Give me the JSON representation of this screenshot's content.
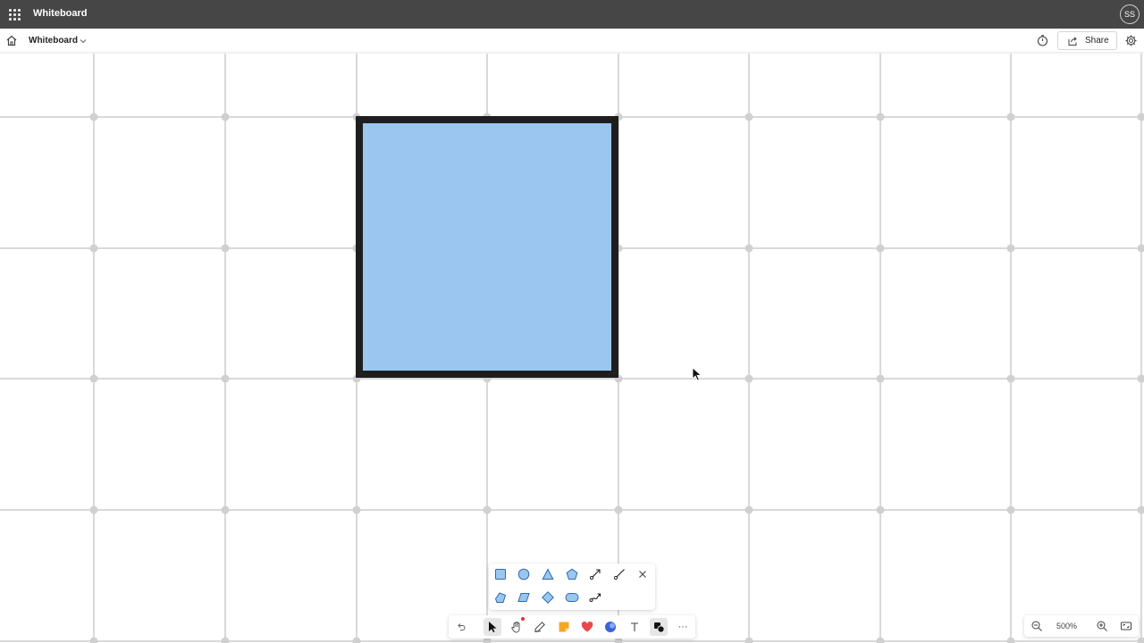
{
  "app": {
    "title": "Whiteboard",
    "user_initials": "SS"
  },
  "command_bar": {
    "board_title": "Whiteboard",
    "share_label": "Share"
  },
  "canvas": {
    "shape": {
      "type": "square",
      "fill_color": "#9ac6ef",
      "stroke_color": "#1e1e1e"
    },
    "grid_color": "#d9d9d9"
  },
  "shapes_panel": {
    "row1": [
      "square",
      "circle",
      "triangle",
      "pentagon",
      "arrow",
      "line",
      "close"
    ],
    "row2": [
      "arrow-shape",
      "parallelogram",
      "diamond",
      "rounded-rectangle",
      "curved-connector"
    ]
  },
  "toolbar": {
    "tools": [
      "undo",
      "select",
      "hand",
      "pen",
      "sticky-note",
      "reactions",
      "stickers",
      "text",
      "shapes",
      "more"
    ],
    "active_tool": "select",
    "more_label": "···"
  },
  "zoom": {
    "level": "500%"
  },
  "colors": {
    "app_bar": "#464646",
    "shape_icon_fill": "#9ac6ef",
    "shape_icon_stroke": "#2b6cb0",
    "sticky_note": "#f7a823",
    "reaction": "#e8484b",
    "sticker": "#3b63d6",
    "accent_dot": "#d13438"
  }
}
